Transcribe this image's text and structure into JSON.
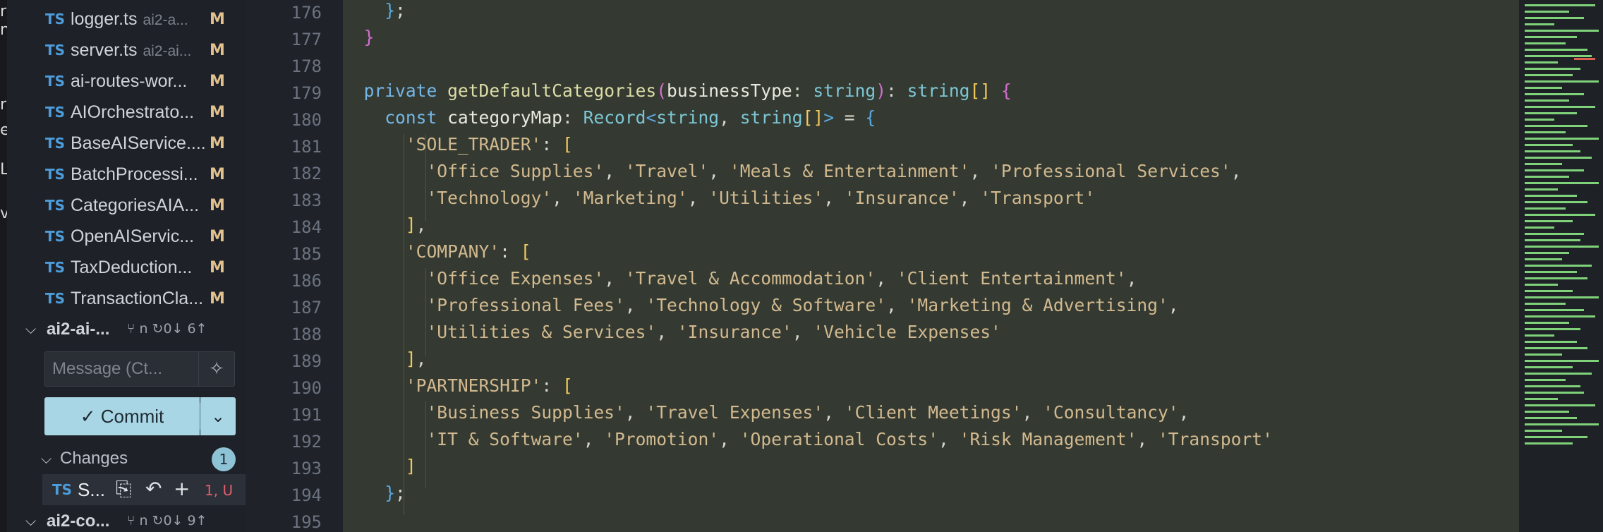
{
  "sidebar": {
    "files": [
      {
        "name": "logger.ts",
        "path": "ai2-a...",
        "status": "M"
      },
      {
        "name": "server.ts",
        "path": "ai2-ai...",
        "status": "M"
      },
      {
        "name": "ai-routes-wor...",
        "path": "",
        "status": "M"
      },
      {
        "name": "AIOrchestrato...",
        "path": "",
        "status": "M"
      },
      {
        "name": "BaseAIService....",
        "path": "",
        "status": "M"
      },
      {
        "name": "BatchProcessi...",
        "path": "",
        "status": "M"
      },
      {
        "name": "CategoriesAIA...",
        "path": "",
        "status": "M"
      },
      {
        "name": "OpenAIServic...",
        "path": "",
        "status": "M"
      },
      {
        "name": "TaxDeduction...",
        "path": "",
        "status": "M"
      },
      {
        "name": "TransactionCla...",
        "path": "",
        "status": "M"
      }
    ],
    "file_type_label": "TS",
    "repo1": {
      "name": "ai2-ai-...",
      "branch": "⑂ n",
      "sync": "↻0↓ 6↑"
    },
    "message_placeholder": "Message (Ct...",
    "commit_label": "✓ Commit",
    "changes_label": "Changes",
    "changes_count": "1",
    "changed_file": {
      "name": "S...",
      "status": "1, U"
    },
    "repo2": {
      "name": "ai2-co...",
      "branch": "⑂ n",
      "sync": "↻0↓ 9↑"
    }
  },
  "editor": {
    "line_numbers": [
      "176",
      "177",
      "178",
      "179",
      "180",
      "181",
      "182",
      "183",
      "184",
      "185",
      "186",
      "187",
      "188",
      "189",
      "190",
      "191",
      "192",
      "193",
      "194",
      "195"
    ]
  },
  "colors": {
    "editor_bg": "#343a31",
    "sidebar_bg": "#1e2127",
    "commit_button": "#a9d6e5",
    "modified_badge": "#e2c08d",
    "typescript_icon": "#4d9ddb",
    "minimap_diff": "#7fd27a"
  }
}
